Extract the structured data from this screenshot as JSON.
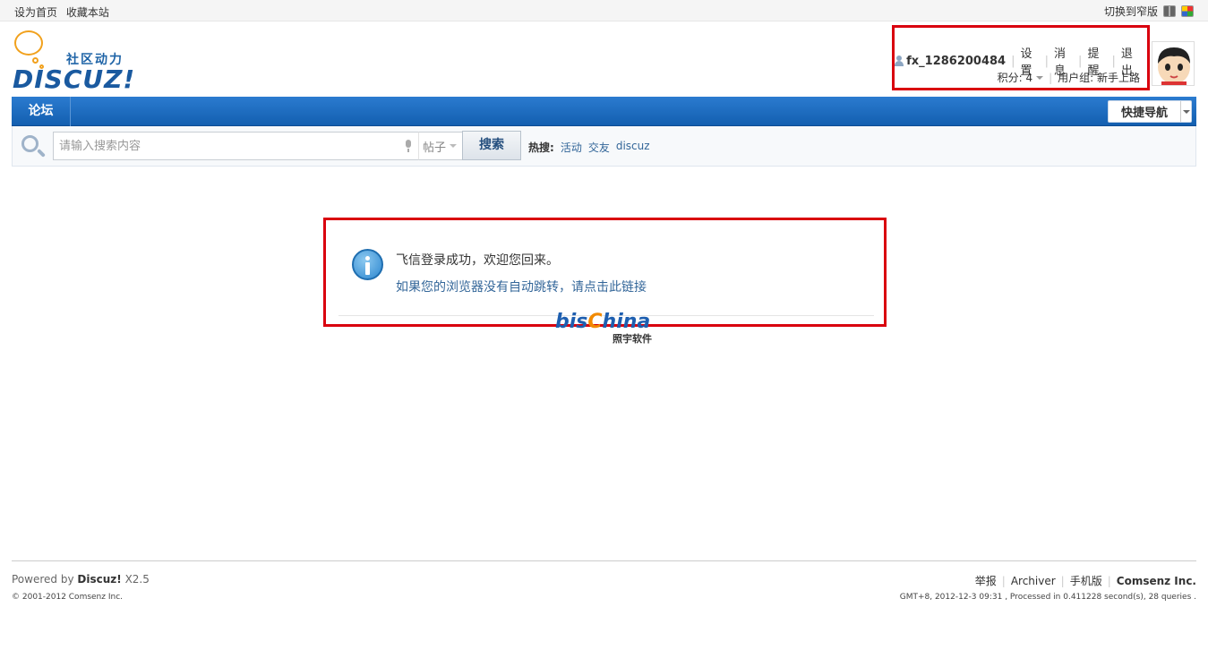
{
  "topbar": {
    "set_home": "设为首页",
    "bookmark": "收藏本站",
    "switch_width": "切换到窄版"
  },
  "logo": {
    "tagline": "社区动力",
    "wordmark": "DISCUZ!"
  },
  "user": {
    "username": "fx_1286200484",
    "settings": "设置",
    "messages": "消息",
    "reminders": "提醒",
    "logout": "退出",
    "credits": "积分: 4",
    "usergroup": "用户组: 新手上路"
  },
  "nav": {
    "forum": "论坛",
    "quick_nav": "快捷导航"
  },
  "search": {
    "placeholder": "请输入搜索内容",
    "type": "帖子",
    "button": "搜索",
    "hot_label": "热搜:",
    "hot_links": [
      "活动",
      "交友",
      "discuz"
    ]
  },
  "message": {
    "line1": "飞信登录成功，欢迎您回来。",
    "line2": "如果您的浏览器没有自动跳转，请点击此链接"
  },
  "watermark": {
    "word_a": "bis",
    "word_b": "C",
    "word_c": "hina",
    "sub": "照宇软件"
  },
  "footer": {
    "powered_prefix": "Powered by",
    "powered_brand": "Discuz!",
    "powered_version": "X2.5",
    "copyright": "© 2001-2012 Comsenz Inc.",
    "links": [
      "举报",
      "Archiver",
      "手机版"
    ],
    "company": "Comsenz Inc.",
    "stats": "GMT+8, 2012-12-3 09:31 , Processed in 0.411228 second(s), 28 queries ."
  },
  "colors": {
    "nav_blue": "#1a6cc4",
    "highlight_red": "#d9000e",
    "link_blue": "#336699"
  }
}
